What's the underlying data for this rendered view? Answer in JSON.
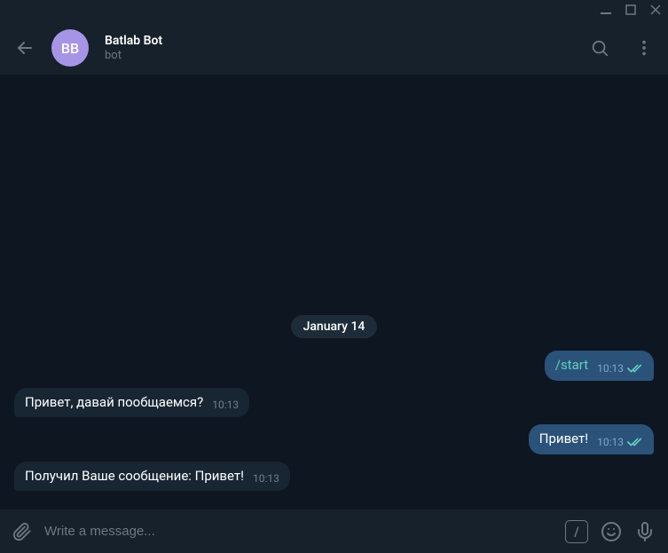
{
  "avatar_initials": "BB",
  "chat": {
    "title": "Batlab Bot",
    "subtitle": "bot"
  },
  "date_label": "January 14",
  "messages": [
    {
      "dir": "out",
      "text": "/start",
      "time": "10:13",
      "cmd": true,
      "read": true
    },
    {
      "dir": "in",
      "text": "Привет, давай пообщаемся?",
      "time": "10:13"
    },
    {
      "dir": "out",
      "text": "Привет!",
      "time": "10:13",
      "read": true
    },
    {
      "dir": "in",
      "text": "Получил Ваше сообщение: Привет!",
      "time": "10:13"
    }
  ],
  "input": {
    "placeholder": "Write a message..."
  },
  "cmd_slash": "/"
}
